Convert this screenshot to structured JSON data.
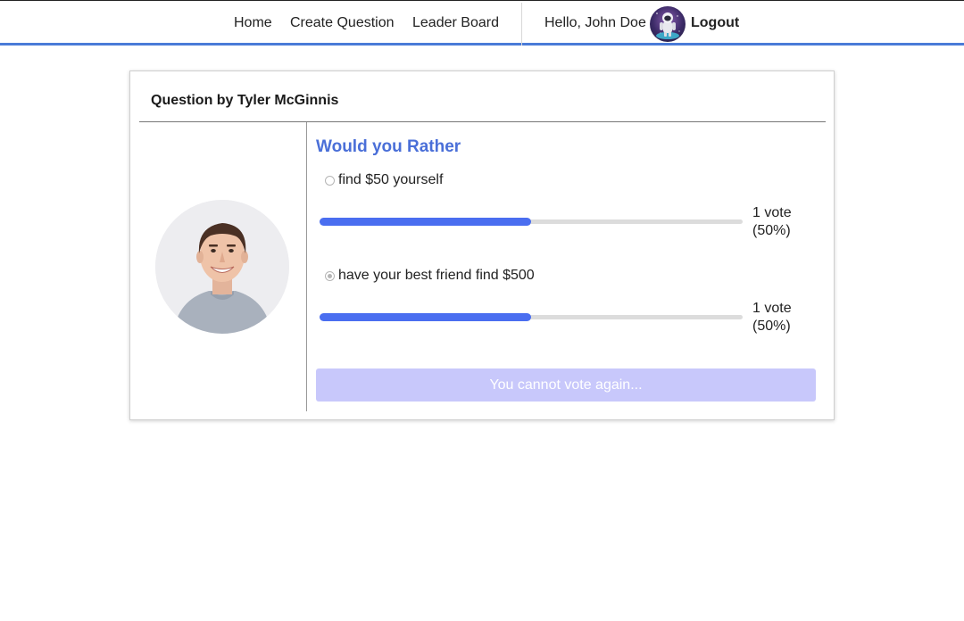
{
  "nav": {
    "links": [
      {
        "label": "Home"
      },
      {
        "label": "Create Question"
      },
      {
        "label": "Leader Board"
      }
    ],
    "greeting": "Hello, John Doe",
    "user_avatar_icon": "astronaut-avatar",
    "logout_label": "Logout"
  },
  "question": {
    "header": "Question by Tyler McGinnis",
    "author_avatar": "person-avatar",
    "title": "Would you Rather",
    "options": [
      {
        "text": "find $50 yourself",
        "selected": false,
        "votes_text": "1 vote",
        "percent_text": "(50%)",
        "fraction": 0.5
      },
      {
        "text": "have your best friend find $500",
        "selected": true,
        "votes_text": "1 vote",
        "percent_text": "(50%)",
        "fraction": 0.5
      }
    ],
    "button_label": "You cannot vote again..."
  },
  "colors": {
    "accent": "#4a7bd8",
    "title": "#4a6fd8",
    "bar": "#4a6ef0",
    "button": "#c8c8fb"
  }
}
